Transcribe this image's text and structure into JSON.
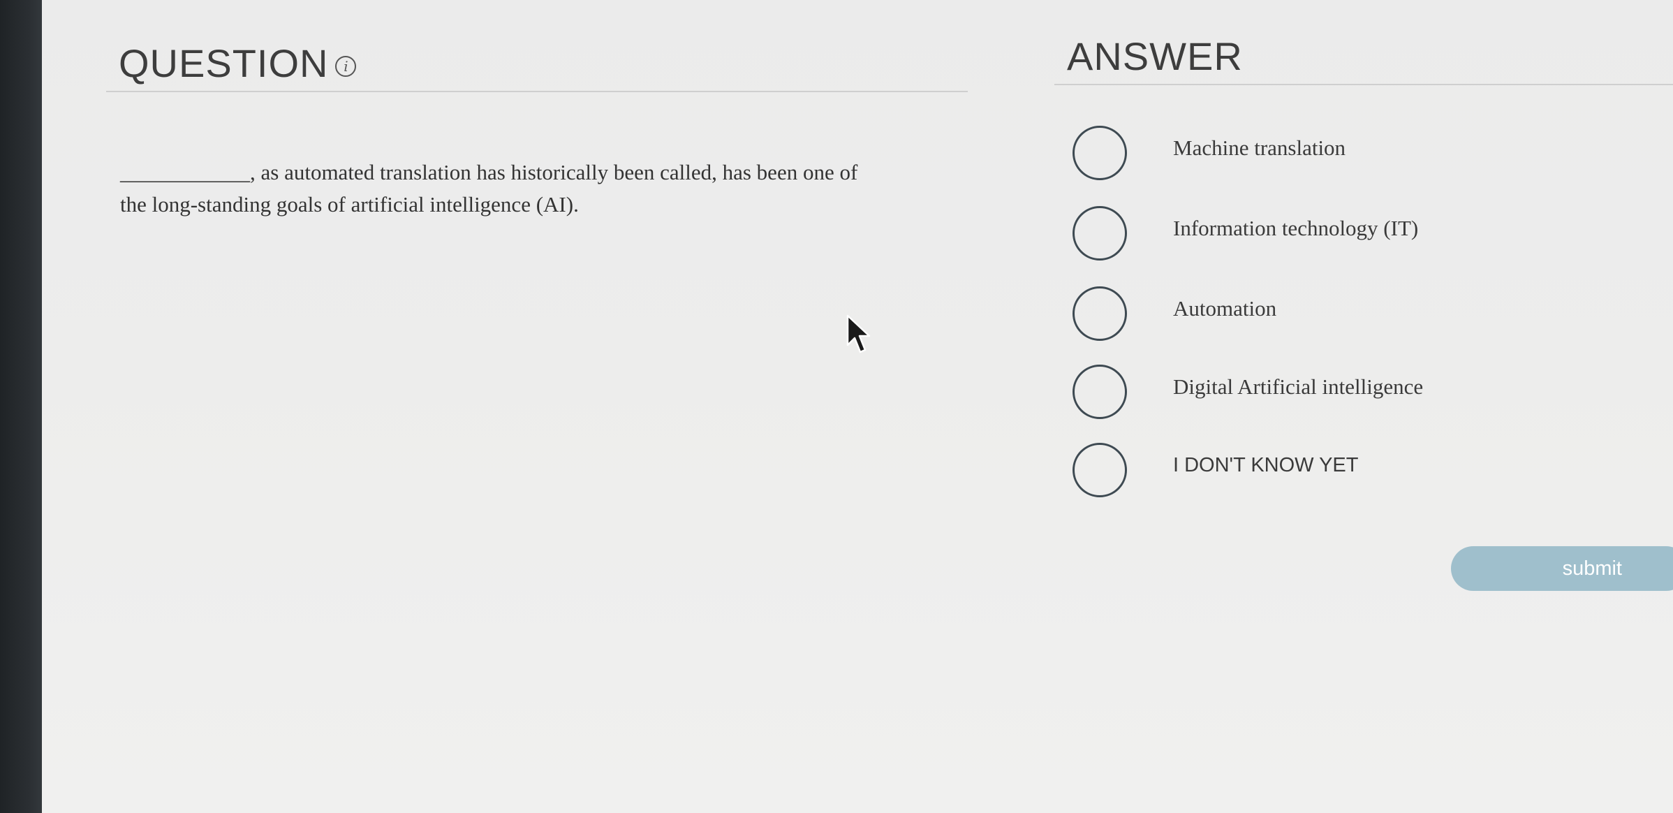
{
  "question": {
    "title": "QUESTION",
    "info_glyph": "i",
    "text_line1": "____________, as automated translation has historically been called, has been one of",
    "text_line2": "the long-standing goals of artificial intelligence (AI)."
  },
  "answer": {
    "title": "ANSWER",
    "options": [
      {
        "label": "Machine translation",
        "selected": false
      },
      {
        "label": "Information technology (IT)",
        "selected": false
      },
      {
        "label": "Automation",
        "selected": false
      },
      {
        "label": "Digital Artificial intelligence",
        "selected": false
      },
      {
        "label": "I DON'T KNOW YET",
        "selected": false
      }
    ]
  },
  "submit": {
    "label": "submit"
  },
  "colors": {
    "accent_button": "#9fbfcc",
    "radio_border": "#3e4a52",
    "heading_text": "#3d3d3d"
  },
  "icons": {
    "info": "info-icon",
    "pointer": "mouse-cursor-icon"
  }
}
